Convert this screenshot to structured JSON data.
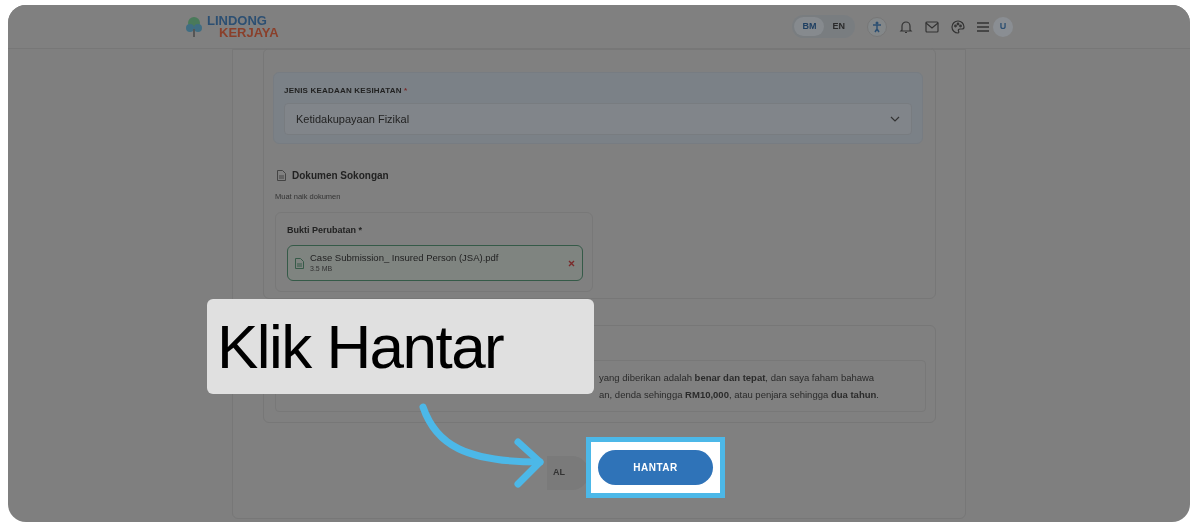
{
  "header": {
    "logo_top": "LINDONG",
    "logo_bottom": "KERJAYA",
    "languages": [
      {
        "label": "BM",
        "selected": true
      },
      {
        "label": "EN",
        "selected": false
      }
    ],
    "avatar": "U"
  },
  "health": {
    "label": "JENIS KEADAAN KESIHATAN",
    "required": "*",
    "value": "Ketidakupayaan Fizikal"
  },
  "documents": {
    "title": "Dokumen Sokongan",
    "hint": "Muat naik dokumen",
    "field_label": "Bukti Perubatan *",
    "file": {
      "name": "Case Submission_ Insured Person (JSA).pdf",
      "size": "3.5 MB"
    }
  },
  "declaration": {
    "line_1": "yang diberikan adalah **benar dan tepat**, dan saya faham bahawa",
    "line_2": "an, denda sehingga **RM10,000**, atau penjara sehingga **dua tahun**."
  },
  "buttons": {
    "cancel": "AL",
    "submit": "HANTAR"
  },
  "callout": {
    "text": "Klik Hantar"
  }
}
